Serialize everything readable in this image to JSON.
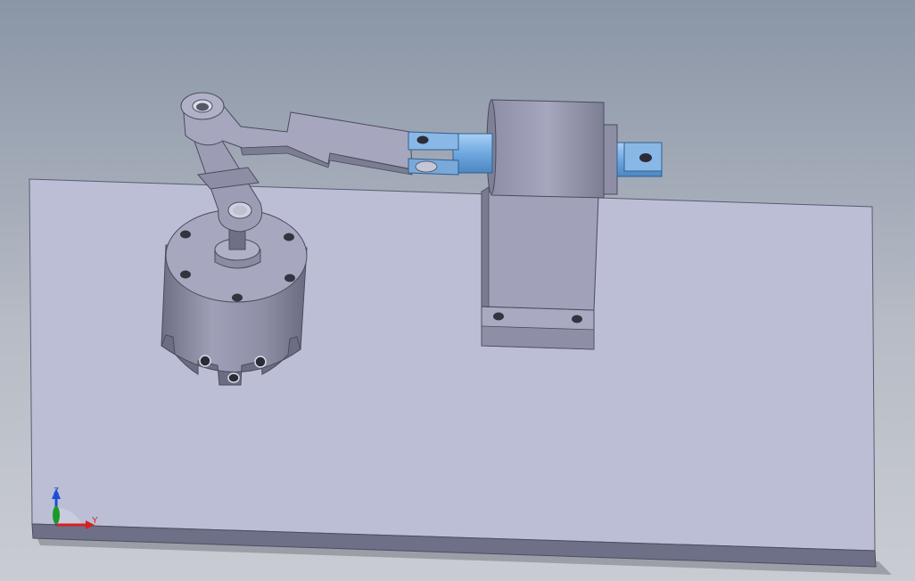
{
  "viewport": {
    "background_top": "#8a95a6",
    "background_bottom": "#c9ccd2"
  },
  "model": {
    "base_plate_color": "#bcbed6",
    "part_color": "#9c9db4",
    "selected_part_color": "#8ab8e6"
  },
  "triad": {
    "z_label": "Z",
    "y_label": "Y",
    "z_color": "#1f4fd6",
    "y_color": "#d62020",
    "x_color": "#1a9a2a"
  }
}
